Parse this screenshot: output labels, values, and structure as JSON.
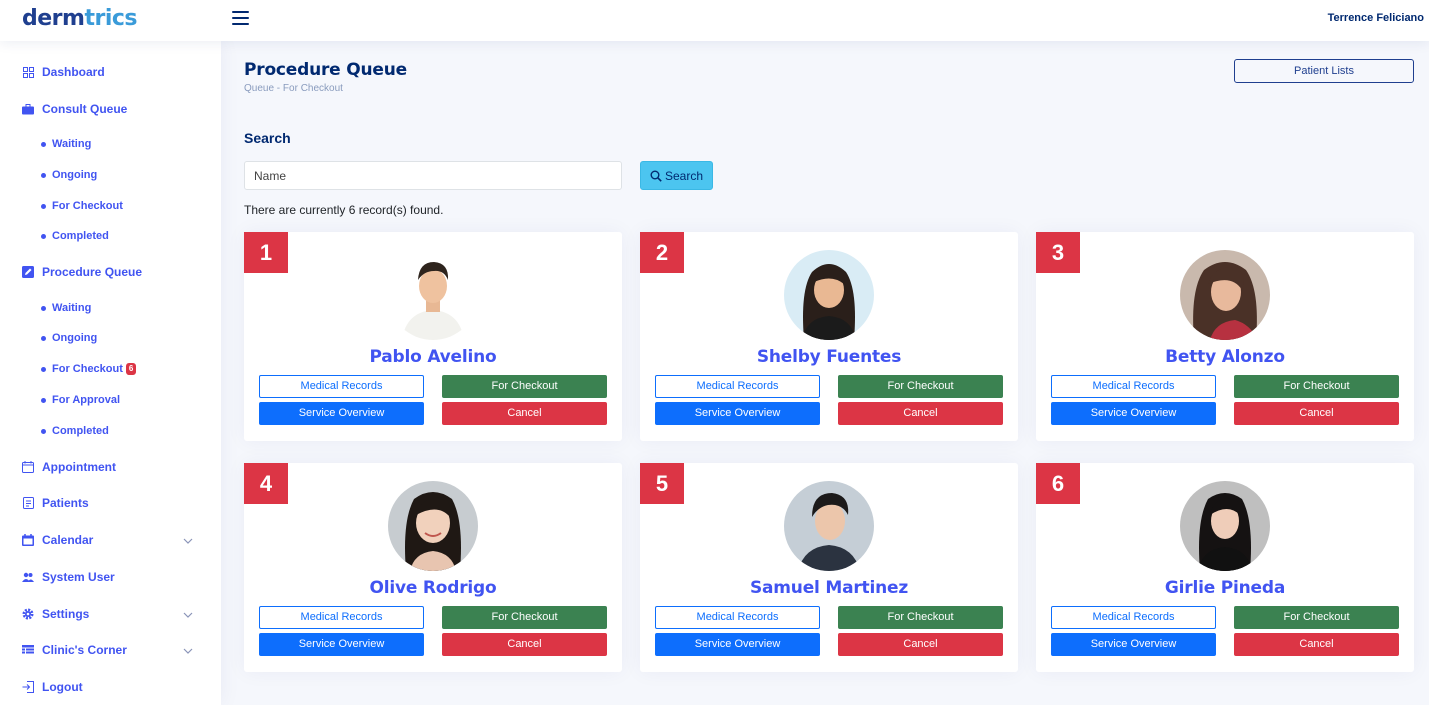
{
  "brand": {
    "part1": "derm",
    "part2": "trics"
  },
  "header": {
    "user_name": "Terrence Feliciano"
  },
  "sidebar": {
    "dashboard": "Dashboard",
    "consult_queue": {
      "label": "Consult Queue",
      "items": [
        "Waiting",
        "Ongoing",
        "For Checkout",
        "Completed"
      ]
    },
    "procedure_queue": {
      "label": "Procedure Queue",
      "items": [
        "Waiting",
        "Ongoing",
        "For Checkout",
        "For Approval",
        "Completed"
      ],
      "checkout_badge": "6"
    },
    "appointment": "Appointment",
    "patients": "Patients",
    "calendar": "Calendar",
    "system_user": "System User",
    "settings": "Settings",
    "clinics_corner": "Clinic's Corner",
    "logout": "Logout"
  },
  "page": {
    "title": "Procedure Queue",
    "breadcrumb": "Queue - For Checkout",
    "patient_lists_button": "Patient Lists"
  },
  "search": {
    "heading": "Search",
    "placeholder": "Name",
    "button": "Search",
    "result_text": "There are currently 6 record(s) found."
  },
  "card_buttons": {
    "medical_records": "Medical Records",
    "for_checkout": "For Checkout",
    "service_overview": "Service Overview",
    "cancel": "Cancel"
  },
  "patients": [
    {
      "number": "1",
      "name": "Pablo Avelino"
    },
    {
      "number": "2",
      "name": "Shelby Fuentes"
    },
    {
      "number": "3",
      "name": "Betty Alonzo"
    },
    {
      "number": "4",
      "name": "Olive Rodrigo"
    },
    {
      "number": "5",
      "name": "Samuel Martinez"
    },
    {
      "number": "6",
      "name": "Girlie Pineda"
    }
  ],
  "colors": {
    "accent": "#4154f1",
    "navy": "#012970",
    "danger": "#dc3545",
    "success": "#3b8251",
    "primary": "#0d6efd",
    "info": "#4cc5f0"
  }
}
